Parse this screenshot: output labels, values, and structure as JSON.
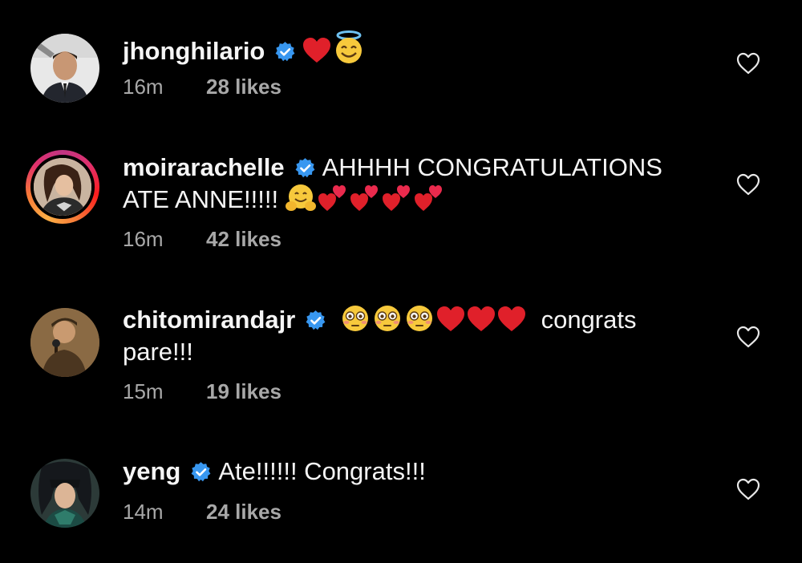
{
  "comments": [
    {
      "username": "jhonghilario",
      "verified": true,
      "text": "",
      "emojis": [
        "red-heart",
        "smiling-face-with-halo"
      ],
      "time": "16m",
      "likes": "28 likes"
    },
    {
      "username": "moirarachelle",
      "verified": true,
      "text": "AHHHH CONGRATULATIONS ATE ANNE!!!!!",
      "emojis": [
        "hugging-face",
        "two-hearts",
        "two-hearts",
        "two-hearts",
        "two-hearts"
      ],
      "time": "16m",
      "likes": "42 likes"
    },
    {
      "username": "chitomirandajr",
      "verified": true,
      "text": "congrats pare!!!",
      "emojis": [
        "flushed-face",
        "flushed-face",
        "flushed-face",
        "red-heart",
        "red-heart",
        "red-heart"
      ],
      "time": "15m",
      "likes": "19 likes"
    },
    {
      "username": "yeng",
      "verified": true,
      "text": "Ate!!!!!! Congrats!!!",
      "emojis": [],
      "time": "14m",
      "likes": "24 likes"
    }
  ],
  "colors": {
    "background": "#000000",
    "text": "#f5f5f5",
    "muted": "#a8a8a8",
    "verified": "#3897f0",
    "heart": "#e0202a"
  },
  "icons": {
    "like": "heart-outline-icon",
    "verified": "verified-badge-icon"
  }
}
